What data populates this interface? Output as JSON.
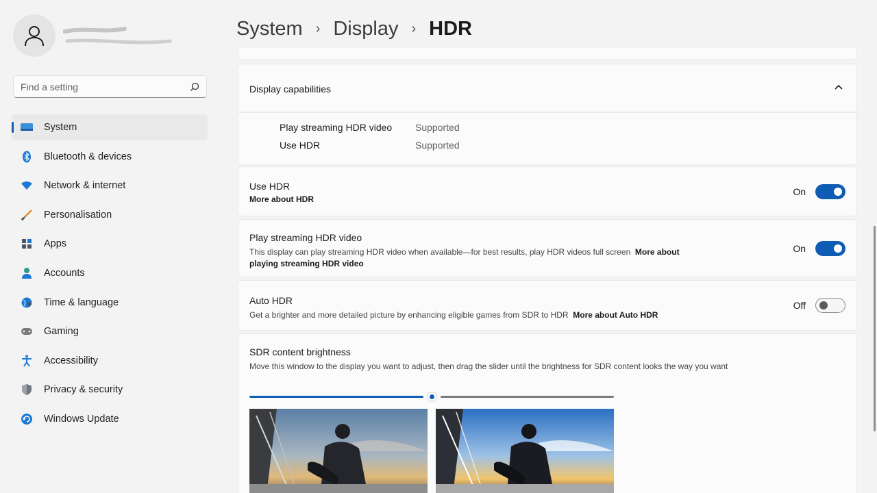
{
  "sidebar": {
    "search": {
      "placeholder": "Find a setting"
    },
    "items": [
      {
        "label": "System",
        "icon": "system-icon",
        "active": true
      },
      {
        "label": "Bluetooth & devices",
        "icon": "bluetooth-icon"
      },
      {
        "label": "Network & internet",
        "icon": "network-icon"
      },
      {
        "label": "Personalisation",
        "icon": "personalisation-icon"
      },
      {
        "label": "Apps",
        "icon": "apps-icon"
      },
      {
        "label": "Accounts",
        "icon": "accounts-icon"
      },
      {
        "label": "Time & language",
        "icon": "time-language-icon"
      },
      {
        "label": "Gaming",
        "icon": "gaming-icon"
      },
      {
        "label": "Accessibility",
        "icon": "accessibility-icon"
      },
      {
        "label": "Privacy & security",
        "icon": "privacy-icon"
      },
      {
        "label": "Windows Update",
        "icon": "windows-update-icon"
      }
    ]
  },
  "breadcrumb": {
    "items": [
      "System",
      "Display",
      "HDR"
    ]
  },
  "capabilities": {
    "title": "Display capabilities",
    "rows": [
      {
        "label": "Play streaming HDR video",
        "value": "Supported"
      },
      {
        "label": "Use HDR",
        "value": "Supported"
      }
    ]
  },
  "use_hdr": {
    "title": "Use HDR",
    "link": "More about HDR",
    "state": "On"
  },
  "streaming": {
    "title": "Play streaming HDR video",
    "desc": "This display can play streaming HDR video when available—for best results, play HDR videos full screen",
    "link1": "More about",
    "link2": "playing streaming HDR video",
    "state": "On"
  },
  "auto_hdr": {
    "title": "Auto HDR",
    "desc": "Get a brighter and more detailed picture by enhancing eligible games from SDR to HDR",
    "link": "More about Auto HDR",
    "state": "Off"
  },
  "sdr": {
    "title": "SDR content brightness",
    "desc": "Move this window to the display you want to adjust, then drag the slider until the brightness for SDR content looks the way you want",
    "slider_value": 0.5
  },
  "colors": {
    "accent": "#0f5cb5"
  }
}
